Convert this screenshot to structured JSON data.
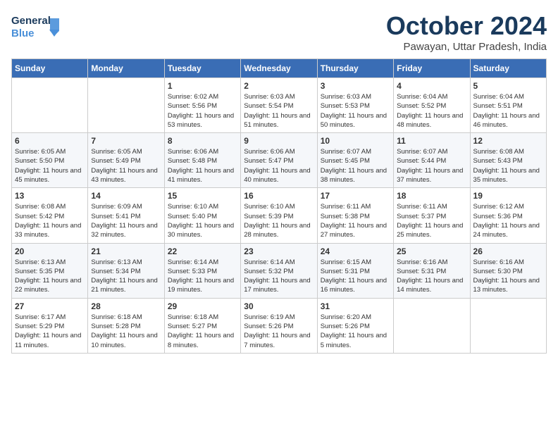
{
  "header": {
    "logo_line1": "General",
    "logo_line2": "Blue",
    "month_title": "October 2024",
    "subtitle": "Pawayan, Uttar Pradesh, India"
  },
  "weekdays": [
    "Sunday",
    "Monday",
    "Tuesday",
    "Wednesday",
    "Thursday",
    "Friday",
    "Saturday"
  ],
  "weeks": [
    [
      {
        "day": "",
        "sunrise": "",
        "sunset": "",
        "daylight": ""
      },
      {
        "day": "",
        "sunrise": "",
        "sunset": "",
        "daylight": ""
      },
      {
        "day": "1",
        "sunrise": "Sunrise: 6:02 AM",
        "sunset": "Sunset: 5:56 PM",
        "daylight": "Daylight: 11 hours and 53 minutes."
      },
      {
        "day": "2",
        "sunrise": "Sunrise: 6:03 AM",
        "sunset": "Sunset: 5:54 PM",
        "daylight": "Daylight: 11 hours and 51 minutes."
      },
      {
        "day": "3",
        "sunrise": "Sunrise: 6:03 AM",
        "sunset": "Sunset: 5:53 PM",
        "daylight": "Daylight: 11 hours and 50 minutes."
      },
      {
        "day": "4",
        "sunrise": "Sunrise: 6:04 AM",
        "sunset": "Sunset: 5:52 PM",
        "daylight": "Daylight: 11 hours and 48 minutes."
      },
      {
        "day": "5",
        "sunrise": "Sunrise: 6:04 AM",
        "sunset": "Sunset: 5:51 PM",
        "daylight": "Daylight: 11 hours and 46 minutes."
      }
    ],
    [
      {
        "day": "6",
        "sunrise": "Sunrise: 6:05 AM",
        "sunset": "Sunset: 5:50 PM",
        "daylight": "Daylight: 11 hours and 45 minutes."
      },
      {
        "day": "7",
        "sunrise": "Sunrise: 6:05 AM",
        "sunset": "Sunset: 5:49 PM",
        "daylight": "Daylight: 11 hours and 43 minutes."
      },
      {
        "day": "8",
        "sunrise": "Sunrise: 6:06 AM",
        "sunset": "Sunset: 5:48 PM",
        "daylight": "Daylight: 11 hours and 41 minutes."
      },
      {
        "day": "9",
        "sunrise": "Sunrise: 6:06 AM",
        "sunset": "Sunset: 5:47 PM",
        "daylight": "Daylight: 11 hours and 40 minutes."
      },
      {
        "day": "10",
        "sunrise": "Sunrise: 6:07 AM",
        "sunset": "Sunset: 5:45 PM",
        "daylight": "Daylight: 11 hours and 38 minutes."
      },
      {
        "day": "11",
        "sunrise": "Sunrise: 6:07 AM",
        "sunset": "Sunset: 5:44 PM",
        "daylight": "Daylight: 11 hours and 37 minutes."
      },
      {
        "day": "12",
        "sunrise": "Sunrise: 6:08 AM",
        "sunset": "Sunset: 5:43 PM",
        "daylight": "Daylight: 11 hours and 35 minutes."
      }
    ],
    [
      {
        "day": "13",
        "sunrise": "Sunrise: 6:08 AM",
        "sunset": "Sunset: 5:42 PM",
        "daylight": "Daylight: 11 hours and 33 minutes."
      },
      {
        "day": "14",
        "sunrise": "Sunrise: 6:09 AM",
        "sunset": "Sunset: 5:41 PM",
        "daylight": "Daylight: 11 hours and 32 minutes."
      },
      {
        "day": "15",
        "sunrise": "Sunrise: 6:10 AM",
        "sunset": "Sunset: 5:40 PM",
        "daylight": "Daylight: 11 hours and 30 minutes."
      },
      {
        "day": "16",
        "sunrise": "Sunrise: 6:10 AM",
        "sunset": "Sunset: 5:39 PM",
        "daylight": "Daylight: 11 hours and 28 minutes."
      },
      {
        "day": "17",
        "sunrise": "Sunrise: 6:11 AM",
        "sunset": "Sunset: 5:38 PM",
        "daylight": "Daylight: 11 hours and 27 minutes."
      },
      {
        "day": "18",
        "sunrise": "Sunrise: 6:11 AM",
        "sunset": "Sunset: 5:37 PM",
        "daylight": "Daylight: 11 hours and 25 minutes."
      },
      {
        "day": "19",
        "sunrise": "Sunrise: 6:12 AM",
        "sunset": "Sunset: 5:36 PM",
        "daylight": "Daylight: 11 hours and 24 minutes."
      }
    ],
    [
      {
        "day": "20",
        "sunrise": "Sunrise: 6:13 AM",
        "sunset": "Sunset: 5:35 PM",
        "daylight": "Daylight: 11 hours and 22 minutes."
      },
      {
        "day": "21",
        "sunrise": "Sunrise: 6:13 AM",
        "sunset": "Sunset: 5:34 PM",
        "daylight": "Daylight: 11 hours and 21 minutes."
      },
      {
        "day": "22",
        "sunrise": "Sunrise: 6:14 AM",
        "sunset": "Sunset: 5:33 PM",
        "daylight": "Daylight: 11 hours and 19 minutes."
      },
      {
        "day": "23",
        "sunrise": "Sunrise: 6:14 AM",
        "sunset": "Sunset: 5:32 PM",
        "daylight": "Daylight: 11 hours and 17 minutes."
      },
      {
        "day": "24",
        "sunrise": "Sunrise: 6:15 AM",
        "sunset": "Sunset: 5:31 PM",
        "daylight": "Daylight: 11 hours and 16 minutes."
      },
      {
        "day": "25",
        "sunrise": "Sunrise: 6:16 AM",
        "sunset": "Sunset: 5:31 PM",
        "daylight": "Daylight: 11 hours and 14 minutes."
      },
      {
        "day": "26",
        "sunrise": "Sunrise: 6:16 AM",
        "sunset": "Sunset: 5:30 PM",
        "daylight": "Daylight: 11 hours and 13 minutes."
      }
    ],
    [
      {
        "day": "27",
        "sunrise": "Sunrise: 6:17 AM",
        "sunset": "Sunset: 5:29 PM",
        "daylight": "Daylight: 11 hours and 11 minutes."
      },
      {
        "day": "28",
        "sunrise": "Sunrise: 6:18 AM",
        "sunset": "Sunset: 5:28 PM",
        "daylight": "Daylight: 11 hours and 10 minutes."
      },
      {
        "day": "29",
        "sunrise": "Sunrise: 6:18 AM",
        "sunset": "Sunset: 5:27 PM",
        "daylight": "Daylight: 11 hours and 8 minutes."
      },
      {
        "day": "30",
        "sunrise": "Sunrise: 6:19 AM",
        "sunset": "Sunset: 5:26 PM",
        "daylight": "Daylight: 11 hours and 7 minutes."
      },
      {
        "day": "31",
        "sunrise": "Sunrise: 6:20 AM",
        "sunset": "Sunset: 5:26 PM",
        "daylight": "Daylight: 11 hours and 5 minutes."
      },
      {
        "day": "",
        "sunrise": "",
        "sunset": "",
        "daylight": ""
      },
      {
        "day": "",
        "sunrise": "",
        "sunset": "",
        "daylight": ""
      }
    ]
  ]
}
